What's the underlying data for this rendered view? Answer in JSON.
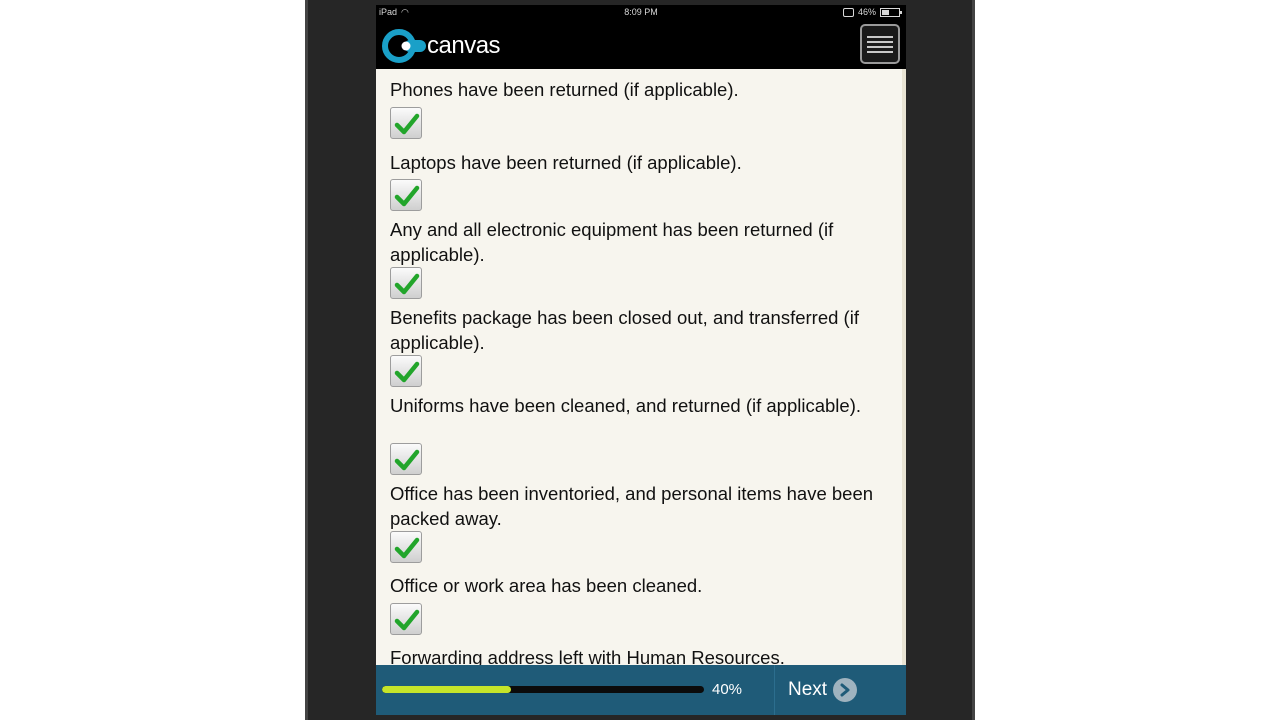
{
  "status_bar": {
    "device": "iPad",
    "time": "8:09 PM",
    "battery": "46%",
    "battery_level": 0.46,
    "wifi_icon": "wifi-icon"
  },
  "header": {
    "logo_text": "canvas",
    "menu_icon": "hamburger-menu-icon",
    "brand_color": "#1aa0c8"
  },
  "checklist": {
    "items": [
      {
        "text": "Phones have been returned (if applicable).",
        "checked": true
      },
      {
        "text": "Laptops have been returned (if applicable).",
        "checked": true
      },
      {
        "text": "Any and all electronic equipment has been returned (if applicable).",
        "checked": true
      },
      {
        "text": "Benefits package has been closed out, and transferred (if applicable).",
        "checked": true
      },
      {
        "text": "Uniforms have been cleaned, and returned (if applicable).",
        "checked": true
      },
      {
        "text": "Office has been inventoried, and personal items have been packed away.",
        "checked": true
      },
      {
        "text": "Office or work area has been cleaned.",
        "checked": true
      },
      {
        "text": "Forwarding address left with Human Resources."
      }
    ],
    "check_color": "#22a52b"
  },
  "footer": {
    "progress": 0.4,
    "progress_text": "40%",
    "next_label": "Next",
    "progress_color": "#c5e52a",
    "bar_color": "#1f5b78"
  }
}
